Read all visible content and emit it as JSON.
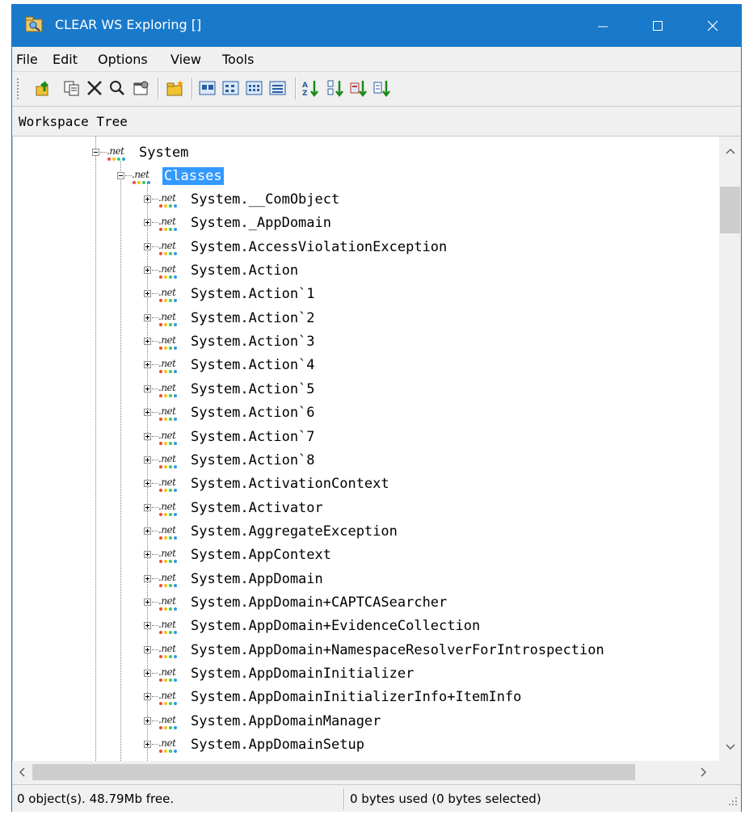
{
  "window": {
    "title": "CLEAR WS Exploring []",
    "accent": "#1979ca"
  },
  "menu": {
    "items": [
      "File",
      "Edit",
      "Options",
      "View",
      "Tools"
    ]
  },
  "toolbar": {
    "icons": [
      "go-up-icon",
      "copy-icon",
      "delete-icon",
      "find-icon",
      "properties-icon",
      "new-folder-icon",
      "large-icons-icon",
      "small-icons-icon",
      "list-view-icon",
      "details-view-icon",
      "sort-by-name-icon",
      "sort-by-type-icon",
      "sort-by-size-icon",
      "sort-by-date-icon"
    ]
  },
  "panel": {
    "title": "Workspace Tree"
  },
  "tree": {
    "root": "System",
    "folder": "Classes",
    "items": [
      "System.__ComObject",
      "System._AppDomain",
      "System.AccessViolationException",
      "System.Action",
      "System.Action`1",
      "System.Action`2",
      "System.Action`3",
      "System.Action`4",
      "System.Action`5",
      "System.Action`6",
      "System.Action`7",
      "System.Action`8",
      "System.ActivationContext",
      "System.Activator",
      "System.AggregateException",
      "System.AppContext",
      "System.AppDomain",
      "System.AppDomain+CAPTCASearcher",
      "System.AppDomain+EvidenceCollection",
      "System.AppDomain+NamespaceResolverForIntrospection",
      "System.AppDomainInitializer",
      "System.AppDomainInitializerInfo+ItemInfo",
      "System.AppDomainManager",
      "System.AppDomainSetup"
    ]
  },
  "status": {
    "left": "0 object(s). 48.79Mb free.",
    "right": "0 bytes used (0 bytes selected)"
  }
}
